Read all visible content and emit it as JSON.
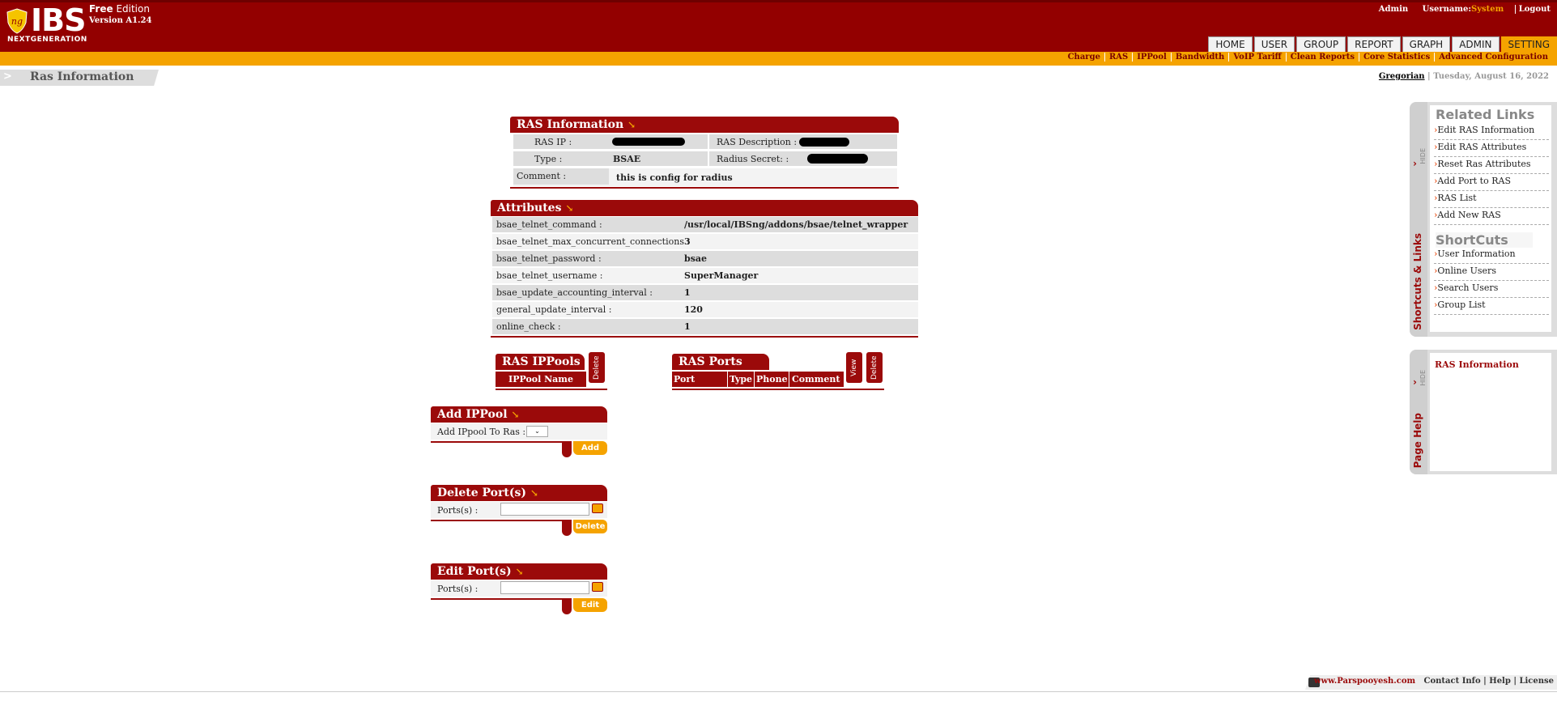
{
  "header": {
    "logo_text": "IBS",
    "logo_subtext": "NEXTGENERATION",
    "edition_bold": "Free",
    "edition_rest": " Edition",
    "version": "Version A1.24",
    "admin": "Admin",
    "username_label": "Username:",
    "username_value": "System",
    "logout": "Logout"
  },
  "main_nav": [
    "HOME",
    "USER",
    "GROUP",
    "REPORT",
    "GRAPH",
    "ADMIN",
    "SETTING"
  ],
  "main_nav_active": "SETTING",
  "sub_nav": [
    "Charge",
    "RAS",
    "IPPool",
    "Bandwidth",
    "VoIP Tariff",
    "Clean Reports",
    "Core Statistics",
    "Advanced Configuration"
  ],
  "breadcrumb": {
    "arrow": ">",
    "title": "Ras Information"
  },
  "date": {
    "calendar": "Gregorian",
    "sep": " | ",
    "date": "Tuesday, August 16, 2022"
  },
  "ras_info": {
    "title": "RAS Information",
    "ip_label": "RAS IP :",
    "desc_label": "RAS Description :",
    "type_label": "Type :",
    "type_value": "BSAE",
    "secret_label": "Radius Secret: :",
    "comment_label": "Comment :",
    "comment_value": "this is config for radius"
  },
  "attributes": {
    "title": "Attributes",
    "rows": [
      {
        "name": "bsae_telnet_command :",
        "value": "/usr/local/IBSng/addons/bsae/telnet_wrapper"
      },
      {
        "name": "bsae_telnet_max_concurrent_connections :",
        "value": "3"
      },
      {
        "name": "bsae_telnet_password :",
        "value": "bsae"
      },
      {
        "name": "bsae_telnet_username :",
        "value": "SuperManager"
      },
      {
        "name": "bsae_update_accounting_interval :",
        "value": "1"
      },
      {
        "name": "general_update_interval :",
        "value": "120"
      },
      {
        "name": "online_check :",
        "value": "1"
      }
    ]
  },
  "ippools": {
    "title": "RAS IPPools",
    "column": "IPPool Name",
    "delete_tab": "Delete"
  },
  "ports_list": {
    "title": "RAS Ports List",
    "columns": [
      "Port Name",
      "Type",
      "Phone",
      "Comment"
    ],
    "view_tab": "View",
    "delete_tab": "Delete"
  },
  "add_ippool": {
    "title": "Add IPPool",
    "label": "Add IPpool To Ras :",
    "button": "Add"
  },
  "delete_ports": {
    "title": "Delete Port(s)",
    "label": "Ports(s) :",
    "button": "Delete"
  },
  "edit_ports": {
    "title": "Edit Port(s)",
    "label": "Ports(s) :",
    "button": "Edit"
  },
  "sidebar": {
    "hide_label": "HIDE",
    "vertical_label": "Shortcuts & Links",
    "related_title": "Related Links",
    "related_links": [
      "Edit RAS Information",
      "Edit RAS Attributes",
      "Reset Ras Attributes",
      "Add Port to RAS",
      "RAS List",
      "Add New RAS"
    ],
    "shortcuts_title": "ShortCuts",
    "shortcuts": [
      "User Information",
      "Online Users",
      "Search Users",
      "Group List"
    ]
  },
  "help_panel": {
    "hide_label": "HIDE",
    "vertical_label": "Page Help",
    "text": "RAS Information"
  },
  "footer": {
    "site": "www.Parspooyesh.com",
    "links": "Contact Info | Help | License"
  },
  "colors": {
    "brand_red": "#930000",
    "accent_orange": "#f5a300"
  }
}
